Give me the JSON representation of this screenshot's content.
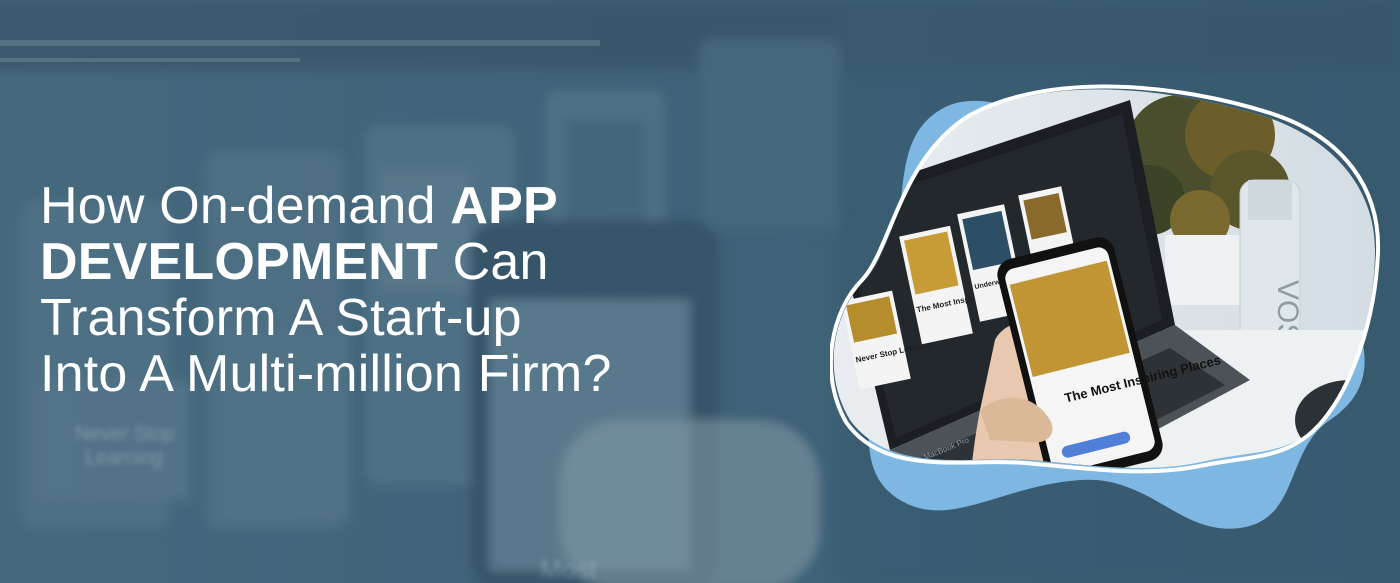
{
  "colors": {
    "background": "#3f6378",
    "headline": "#ffffff",
    "blob_accent": "#7db7e2",
    "ring": "#ffffff"
  },
  "headline": {
    "line1_light": "How On-demand ",
    "line1_bold": "APP",
    "line2_bold": "DEVELOPMENT",
    "line2_light": " Can",
    "line3": "Transform A Start-up",
    "line4": "Into A Multi-million Firm?"
  },
  "background_photo": {
    "card_label_1": "Never Stop",
    "card_label_2": "Learning",
    "card_label_3": "Most"
  },
  "illustration": {
    "card_never_stop": "Never Stop Learning",
    "card_most_inspiring": "The Most Inspiring Places",
    "card_underwater": "Underwater Plants Collection",
    "phone_title": "The Most Inspiring Places",
    "bottle_text": "VOSS",
    "laptop_brand": "MacBook Pro"
  }
}
